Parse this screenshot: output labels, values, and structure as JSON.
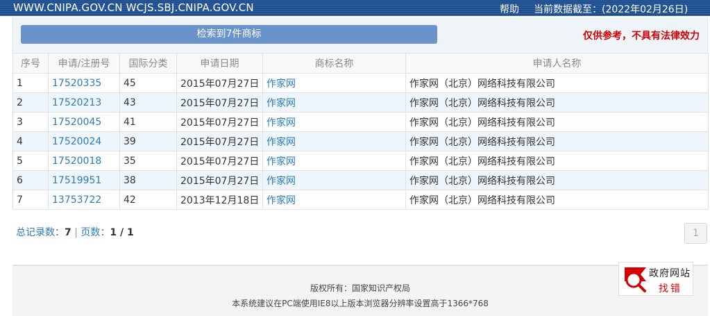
{
  "topbar": {
    "domains": "WWW.CNIPA.GOV.CN WCJS.SBJ.CNIPA.GOV.CN",
    "help": "帮助",
    "date_note": "当前数据截至：(2022年02月26日)"
  },
  "result_header": {
    "search_button": "检索到7件商标",
    "disclaimer": "仅供参考，不具有法律效力"
  },
  "table": {
    "columns": [
      "序号",
      "申请/注册号",
      "国际分类",
      "申请日期",
      "商标名称",
      "申请人名称"
    ],
    "rows": [
      {
        "no": "1",
        "reg_no": "17520335",
        "class": "45",
        "date": "2015年07月27日",
        "mark": "作家网",
        "applicant": "作家网（北京）网络科技有限公司"
      },
      {
        "no": "2",
        "reg_no": "17520213",
        "class": "43",
        "date": "2015年07月27日",
        "mark": "作家网",
        "applicant": "作家网（北京）网络科技有限公司"
      },
      {
        "no": "3",
        "reg_no": "17520045",
        "class": "41",
        "date": "2015年07月27日",
        "mark": "作家网",
        "applicant": "作家网（北京）网络科技有限公司"
      },
      {
        "no": "4",
        "reg_no": "17520024",
        "class": "39",
        "date": "2015年07月27日",
        "mark": "作家网",
        "applicant": "作家网（北京）网络科技有限公司"
      },
      {
        "no": "5",
        "reg_no": "17520018",
        "class": "35",
        "date": "2015年07月27日",
        "mark": "作家网",
        "applicant": "作家网（北京）网络科技有限公司"
      },
      {
        "no": "6",
        "reg_no": "17519951",
        "class": "38",
        "date": "2015年07月27日",
        "mark": "作家网",
        "applicant": "作家网（北京）网络科技有限公司"
      },
      {
        "no": "7",
        "reg_no": "13753722",
        "class": "42",
        "date": "2013年12月18日",
        "mark": "作家网",
        "applicant": "作家网（北京）网络科技有限公司"
      }
    ]
  },
  "pagination": {
    "total_label": "总记录数：",
    "total": "7",
    "separator": "|",
    "pages_label": "页数：",
    "pages": "1 / 1",
    "page_button": "1"
  },
  "footer": {
    "copyright": "版权所有：国家知识产权局",
    "browser_note": "本系统建议在PC端使用IE8以上版本浏览器分辨率设置高于1366*768"
  },
  "gov_badge": {
    "title": "政府网站",
    "action": "找错",
    "icon": "magnifier-flag-icon"
  },
  "colors": {
    "topbar": "#1c4e8f",
    "button": "#6a93cc",
    "link": "#2a7bbd",
    "disclaimer": "#d20000"
  }
}
